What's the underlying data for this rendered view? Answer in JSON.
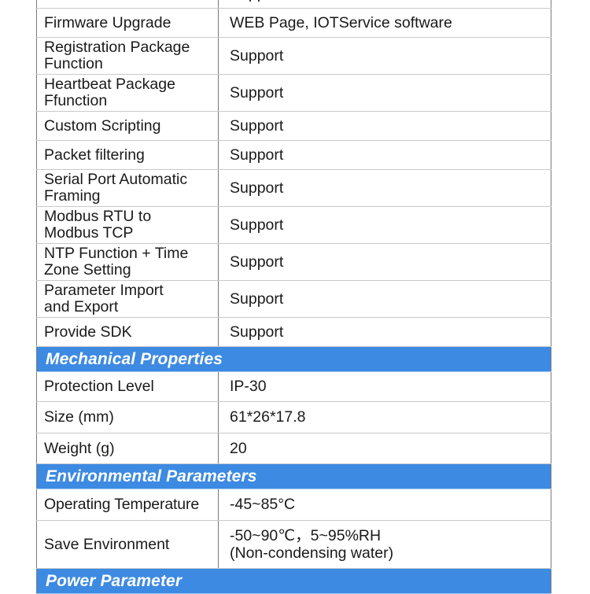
{
  "document": {
    "type": "product-specification-table",
    "accent_color": "#3d8ae2",
    "header_text_color": "#ffffff",
    "body_text_color": "#1a1a1a",
    "border_color": "#7a7a7a",
    "inner_border_color": "#c9c9c9"
  },
  "table": {
    "rows": [
      {
        "kind": "spec",
        "label": "",
        "value": "Support",
        "clipped": true
      },
      {
        "kind": "spec",
        "label": "Firmware Upgrade",
        "value": "WEB Page, IOTService software"
      },
      {
        "kind": "spec",
        "label_line1": "Registration Package",
        "label_line2": "Function",
        "value": "Support"
      },
      {
        "kind": "spec",
        "label_line1": "Heartbeat Package",
        "label_line2": "Ffunction",
        "value": "Support"
      },
      {
        "kind": "spec",
        "label": "Custom Scripting",
        "value": "Support"
      },
      {
        "kind": "spec",
        "label": "Packet filtering",
        "value": "Support"
      },
      {
        "kind": "spec",
        "label_line1": "Serial Port Automatic",
        "label_line2": "Framing",
        "value": "Support"
      },
      {
        "kind": "spec",
        "label_line1": "Modbus RTU to",
        "label_line2": "Modbus TCP",
        "value": "Support"
      },
      {
        "kind": "spec",
        "label_line1": "NTP Function + Time",
        "label_line2": "Zone Setting",
        "value": "Support"
      },
      {
        "kind": "spec",
        "label_line1": "Parameter Import",
        "label_line2": "and Export",
        "value": "Support"
      },
      {
        "kind": "spec",
        "label": "Provide SDK",
        "value": "Support"
      },
      {
        "kind": "section",
        "title": "Mechanical Properties"
      },
      {
        "kind": "spec",
        "label": "Protection Level",
        "value": "IP-30"
      },
      {
        "kind": "spec",
        "label": "Size (mm)",
        "value": "61*26*17.8"
      },
      {
        "kind": "spec",
        "label": "Weight (g)",
        "value": "20"
      },
      {
        "kind": "section",
        "title": "Environmental Parameters"
      },
      {
        "kind": "spec",
        "label": "Operating Temperature",
        "value": "-45~85°C"
      },
      {
        "kind": "spec",
        "label": "Save Environment",
        "value_line1": "-50~90℃，5~95%RH",
        "value_line2": "(Non-condensing water)"
      },
      {
        "kind": "section",
        "title": "Power Parameter"
      }
    ]
  },
  "rows": {
    "clipped_support": "Support",
    "firmware_upgrade_label": "Firmware Upgrade",
    "firmware_upgrade_value": "WEB Page, IOTService software",
    "registration_label_1": "Registration Package",
    "registration_label_2": "Function",
    "registration_value": "Support",
    "heartbeat_label_1": "Heartbeat Package",
    "heartbeat_label_2": "Ffunction",
    "heartbeat_value": "Support",
    "custom_scripting_label": "Custom Scripting",
    "custom_scripting_value": "Support",
    "packet_filtering_label": "Packet filtering",
    "packet_filtering_value": "Support",
    "serial_framing_label_1": "Serial Port Automatic",
    "serial_framing_label_2": "Framing",
    "serial_framing_value": "Support",
    "modbus_label_1": "Modbus RTU to",
    "modbus_label_2": "Modbus TCP",
    "modbus_value": "Support",
    "ntp_label_1": "NTP Function + Time",
    "ntp_label_2": "Zone Setting",
    "ntp_value": "Support",
    "param_io_label_1": "Parameter Import",
    "param_io_label_2": "and Export",
    "param_io_value": "Support",
    "provide_sdk_label": "Provide SDK",
    "provide_sdk_value": "Support",
    "protection_level_label": "Protection Level",
    "protection_level_value": "IP-30",
    "size_label": "Size (mm)",
    "size_value": "61*26*17.8",
    "weight_label": "Weight (g)",
    "weight_value": "20",
    "operating_temp_label": "Operating Temperature",
    "operating_temp_value": "-45~85°C",
    "save_env_label": "Save Environment",
    "save_env_value_1": "-50~90℃，5~95%RH",
    "save_env_value_2": "(Non-condensing water)"
  },
  "sections": {
    "mechanical": "Mechanical Properties",
    "environmental": "Environmental Parameters",
    "power": "Power Parameter"
  }
}
